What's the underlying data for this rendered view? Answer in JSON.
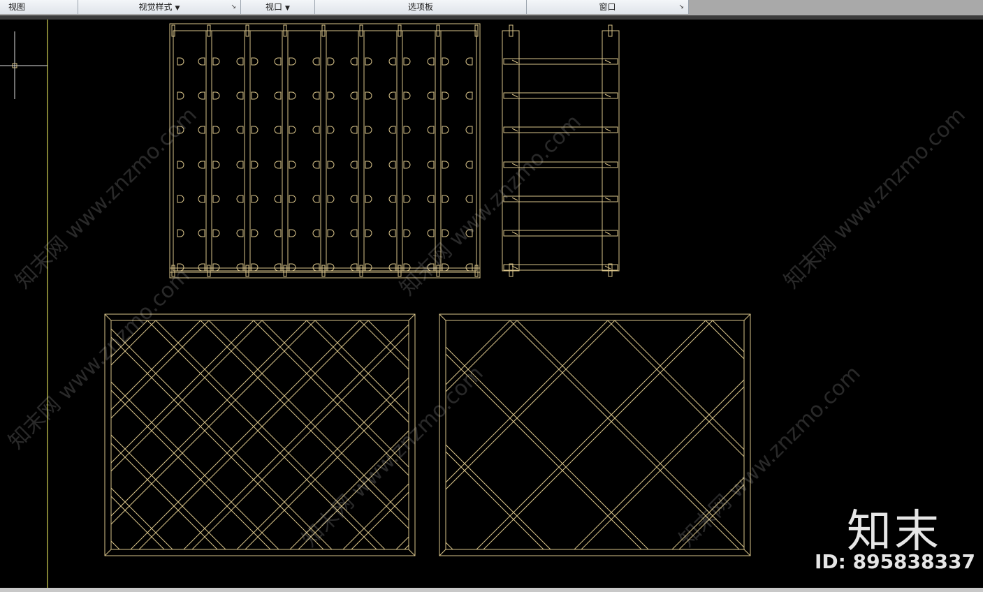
{
  "ribbon": {
    "panels": [
      {
        "label": "视图"
      },
      {
        "label": "视觉样式"
      },
      {
        "label": "视口"
      },
      {
        "label": "选项板"
      },
      {
        "label": "窗口"
      }
    ]
  },
  "watermark": {
    "logo": "知末",
    "id_text": "ID: 895838337",
    "site": "知末网 www.znzmo.com"
  },
  "colors": {
    "cad_line": "#d9c48a",
    "ucs_axis": "#ffff66",
    "background": "#000000"
  }
}
